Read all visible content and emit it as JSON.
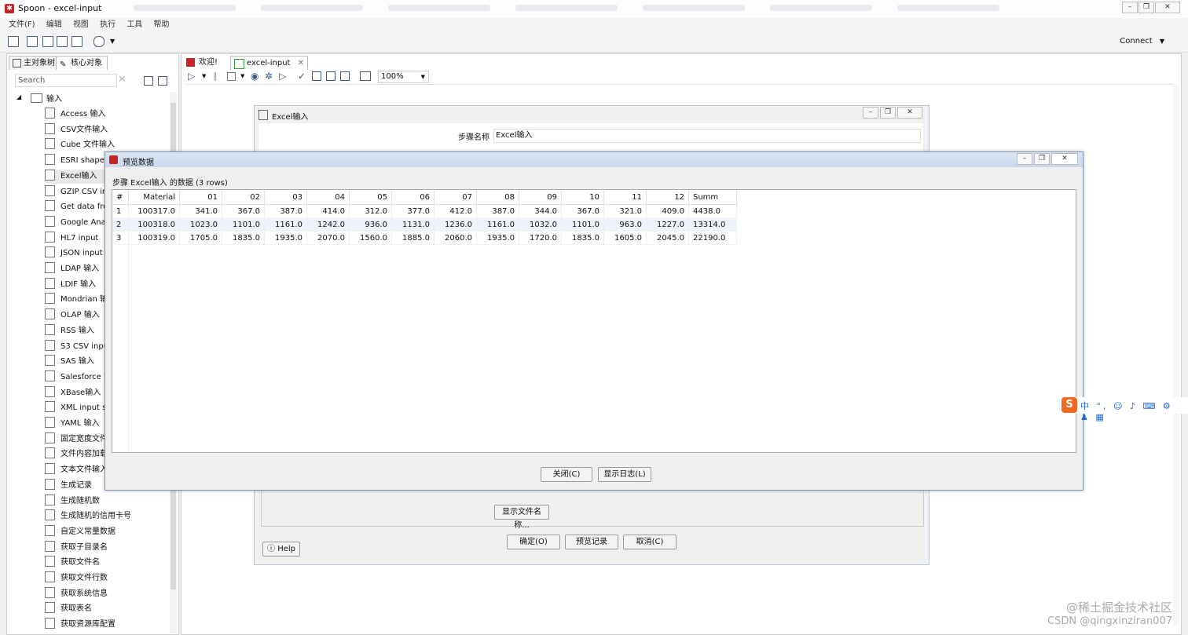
{
  "window": {
    "title": "Spoon - excel-input",
    "controls": [
      "minimize",
      "restore",
      "close"
    ]
  },
  "menu": [
    "文件(F)",
    "编辑",
    "视图",
    "执行",
    "工具",
    "帮助"
  ],
  "toolbar": {
    "connect_label": "Connect"
  },
  "left_panel": {
    "tabs": [
      "主对象树",
      "核心对象"
    ],
    "search_placeholder": "Search",
    "category": "输入",
    "items": [
      "Access 输入",
      "CSV文件输入",
      "Cube 文件输入",
      "ESRI shapef",
      "Excel输入",
      "GZIP CSV in",
      "Get data fro",
      "Google Ana",
      "HL7 input",
      "JSON input",
      "LDAP 输入",
      "LDIF 输入",
      "Mondrian 输",
      "OLAP 输入",
      "RSS 输入",
      "S3 CSV inpu",
      "SAS 输入",
      "Salesforce i",
      "XBase输入",
      "XML input s",
      "YAML 输入",
      "固定宽度文件",
      "文件内容加载",
      "文本文件输入",
      "生成记录",
      "生成随机数",
      "生成随机的信用卡号",
      "自定义常量数据",
      "获取子目录名",
      "获取文件名",
      "获取文件行数",
      "获取系统信息",
      "获取表名",
      "获取资源库配置"
    ]
  },
  "editor": {
    "tabs": [
      "欢迎!",
      "excel-input"
    ],
    "zoom": "100%"
  },
  "excel_dialog": {
    "title": "Excel输入",
    "step_name_label": "步骤名称",
    "step_name_value": "Excel输入",
    "show_filenames_button": "显示文件名称...",
    "ok_button": "确定(O)",
    "preview_button": "预览记录",
    "cancel_button": "取消(C)",
    "help_button": "Help"
  },
  "preview_dialog": {
    "title": "预览数据",
    "label": "步骤 Excel输入 的数据  (3 rows)",
    "columns": [
      "#",
      "Material",
      "01",
      "02",
      "03",
      "04",
      "05",
      "06",
      "07",
      "08",
      "09",
      "10",
      "11",
      "12",
      "Summ"
    ],
    "rows": [
      [
        "1",
        "100317.0",
        "341.0",
        "367.0",
        "387.0",
        "414.0",
        "312.0",
        "377.0",
        "412.0",
        "387.0",
        "344.0",
        "367.0",
        "321.0",
        "409.0",
        "4438.0"
      ],
      [
        "2",
        "100318.0",
        "1023.0",
        "1101.0",
        "1161.0",
        "1242.0",
        "936.0",
        "1131.0",
        "1236.0",
        "1161.0",
        "1032.0",
        "1101.0",
        "963.0",
        "1227.0",
        "13314.0"
      ],
      [
        "3",
        "100319.0",
        "1705.0",
        "1835.0",
        "1935.0",
        "2070.0",
        "1560.0",
        "1885.0",
        "2060.0",
        "1935.0",
        "1720.0",
        "1835.0",
        "1605.0",
        "2045.0",
        "22190.0"
      ]
    ],
    "close_button": "关闭(C)",
    "show_log_button": "显示日志(L)"
  },
  "ime_bar": {
    "logo": "S",
    "mode": "中"
  },
  "watermark": {
    "line1": "@稀土掘金技术社区",
    "line2": "CSDN @qingxinziran007"
  }
}
